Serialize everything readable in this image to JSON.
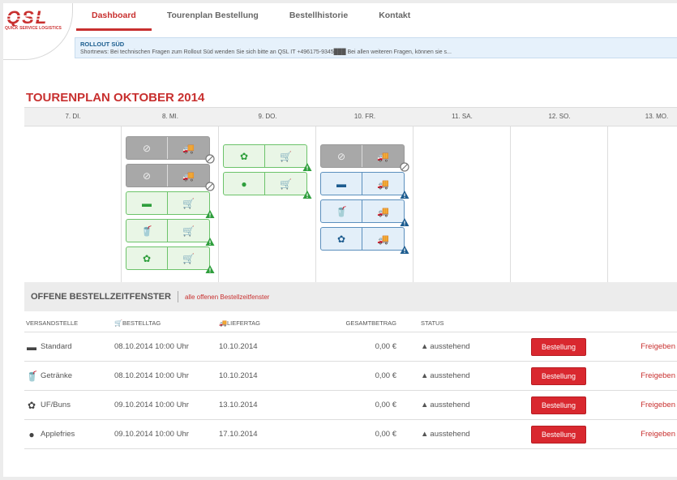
{
  "logo": {
    "text": "QSL",
    "subtitle": "QUICK SERVICE LOGISTICS"
  },
  "nav": [
    {
      "label": "Dashboard",
      "active": true
    },
    {
      "label": "Tourenplan Bestellung",
      "active": false
    },
    {
      "label": "Bestellhistorie",
      "active": false
    },
    {
      "label": "Kontakt",
      "active": false
    }
  ],
  "news": {
    "title": "ROLLOUT SÜD",
    "text": "Shortnews: Bei technischen Fragen zum Rollout Süd wenden Sie sich bitte an QSL IT +496175-9345███ Bei allen weiteren Fragen, können sie s..."
  },
  "calendar": {
    "title": "TOURENPLAN OKTOBER 2014",
    "days": [
      "7. DI.",
      "8. MI.",
      "9. DO.",
      "10. FR.",
      "11. SA.",
      "12. SO.",
      "13. MO."
    ]
  },
  "open_orders": {
    "title": "OFFENE BESTELLZEITFENSTER",
    "link": "alle offenen Bestellzeitfenster",
    "headers": {
      "versandstelle": "VERSANDSTELLE",
      "bestelltag": "BESTELLTAG",
      "liefertag": "LIEFERTAG",
      "gesamtbetrag": "GESAMTBETRAG",
      "status": "STATUS"
    },
    "rows": [
      {
        "icon": "burger-icon",
        "name": "Standard",
        "bestelltag": "08.10.2014 10:00 Uhr",
        "liefertag": "10.10.2014",
        "betrag": "0,00 €",
        "status": "ausstehend",
        "button": "Bestellung",
        "action": "Freigeben"
      },
      {
        "icon": "drink-icon",
        "name": "Getränke",
        "bestelltag": "08.10.2014 10:00 Uhr",
        "liefertag": "10.10.2014",
        "betrag": "0,00 €",
        "status": "ausstehend",
        "button": "Bestellung",
        "action": "Freigeben"
      },
      {
        "icon": "lettuce-icon",
        "name": "UF/Buns",
        "bestelltag": "09.10.2014 10:00 Uhr",
        "liefertag": "13.10.2014",
        "betrag": "0,00 €",
        "status": "ausstehend",
        "button": "Bestellung",
        "action": "Freigeben"
      },
      {
        "icon": "apple-icon",
        "name": "Applefries",
        "bestelltag": "09.10.2014 10:00 Uhr",
        "liefertag": "17.10.2014",
        "betrag": "0,00 €",
        "status": "ausstehend",
        "button": "Bestellung",
        "action": "Freigeben"
      }
    ]
  },
  "colors": {
    "brand": "#c8302f",
    "green": "#2e9e3c",
    "blue": "#1d5c8f",
    "button": "#d9282f"
  }
}
